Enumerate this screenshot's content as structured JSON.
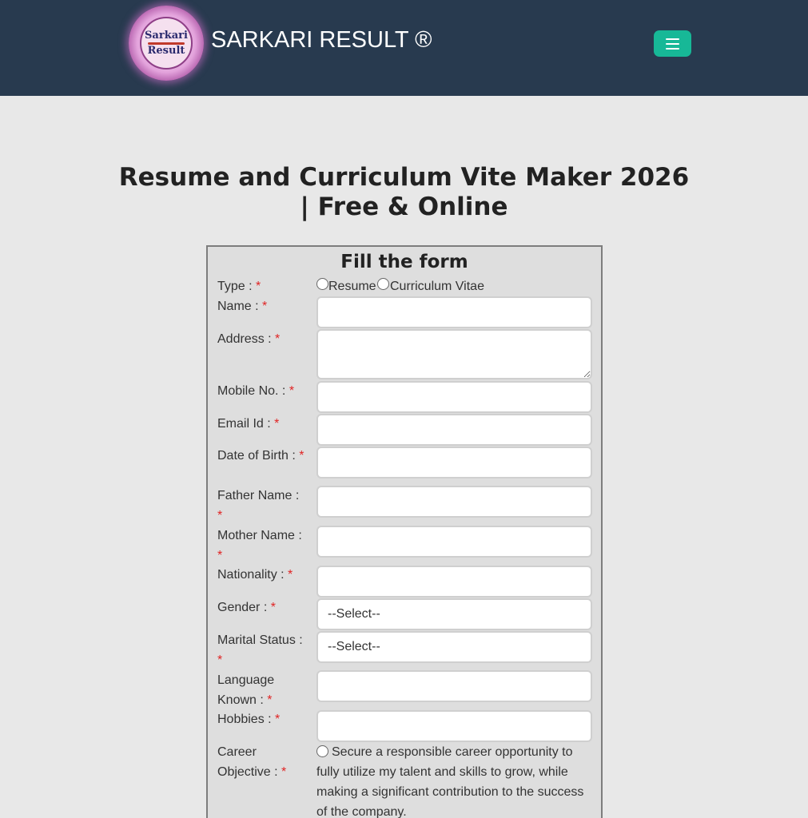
{
  "header": {
    "site_title": "SARKARI RESULT ®",
    "logo_line1": "Sarkari",
    "logo_line2": "Result",
    "menu_icon": "hamburger-menu-icon",
    "brand_color": "#283a4f",
    "accent_color": "#17b897"
  },
  "page": {
    "title": "Resume and Curriculum Vite Maker 2026 | Free & Online"
  },
  "form": {
    "heading": "Fill the form",
    "required_mark": "*",
    "type_label": "Type :",
    "type_options": [
      "Resume",
      "Curriculum Vitae"
    ],
    "name_label": "Name :",
    "address_label": "Address :",
    "mobile_label": "Mobile No. :",
    "email_label": "Email Id :",
    "dob_label": "Date of Birth :",
    "father_label": "Father Name :",
    "mother_label": "Mother Name :",
    "nationality_label": "Nationality :",
    "gender_label": "Gender :",
    "gender_value": "--Select--",
    "marital_label": "Marital Status :",
    "marital_value": "--Select--",
    "language_label": "Language Known :",
    "hobbies_label": "Hobbies :",
    "career_label": "Career Objective :",
    "career_option": "Secure a responsible career opportunity to fully utilize my talent and skills to grow, while making a significant contribution to the success of the company."
  }
}
